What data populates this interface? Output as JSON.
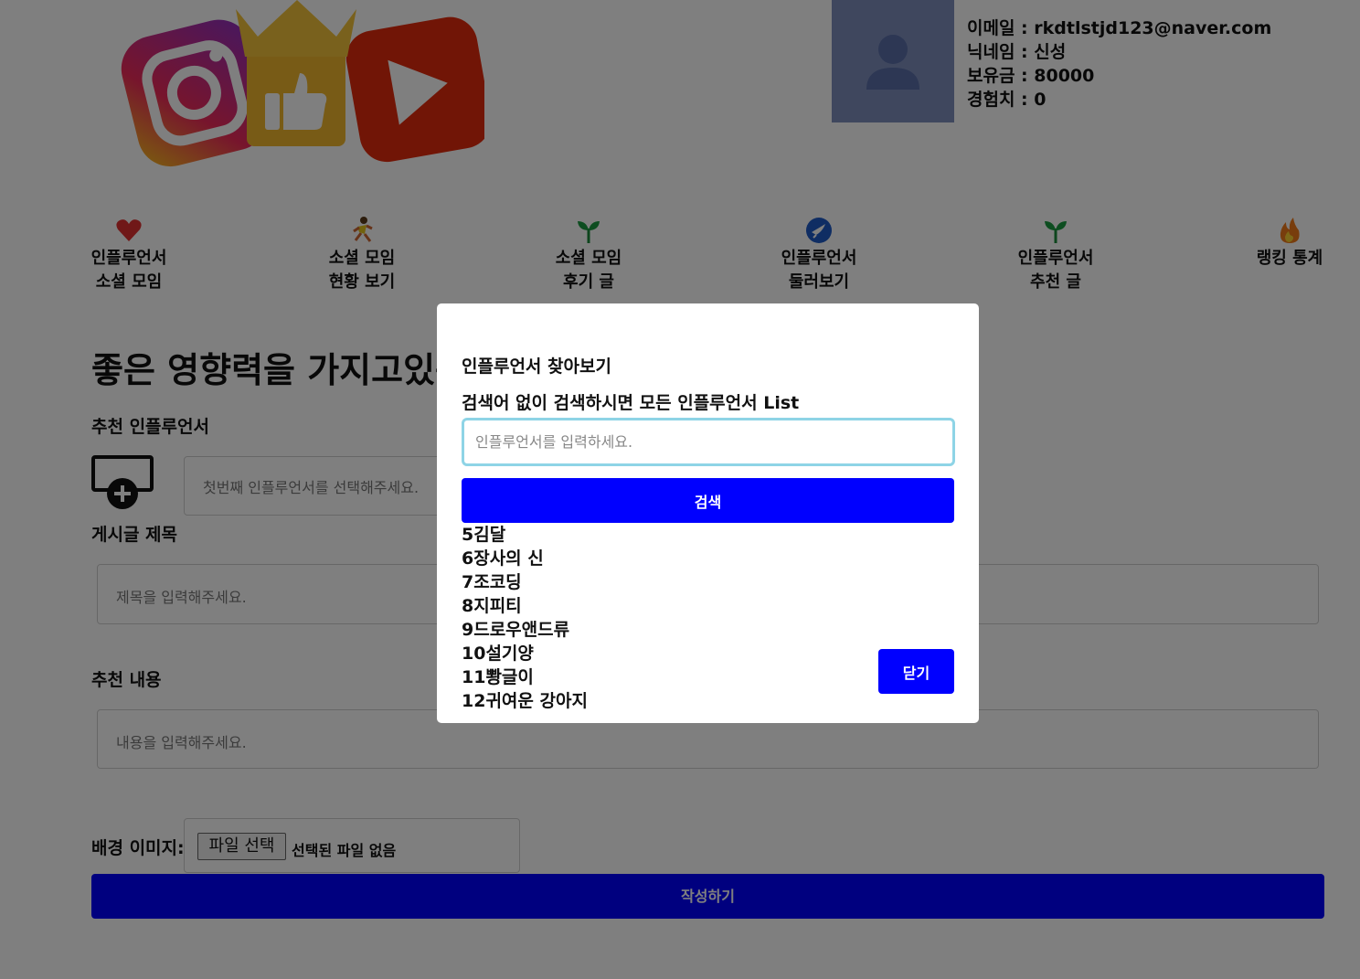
{
  "profile": {
    "email": "이메일 : rkdtlstjd123@naver.com",
    "nickname": "닉네임 : 신성",
    "balance": "보유금 : 80000",
    "experience": "경험치 : 0"
  },
  "nav": {
    "items": [
      {
        "label": "인플루언서\n소셜 모임",
        "icon": "heart-icon"
      },
      {
        "label": "소셜 모임\n현황 보기",
        "icon": "runner-icon"
      },
      {
        "label": "소셜 모임\n후기 글",
        "icon": "sprout-icon"
      },
      {
        "label": "인플루언서\n둘러보기",
        "icon": "bird-icon"
      },
      {
        "label": "인플루언서\n추천 글",
        "icon": "sprout-icon"
      },
      {
        "label": "랭킹 통계",
        "icon": "fire-icon"
      }
    ]
  },
  "main": {
    "title": "좋은 영향력을 가지고있는",
    "recommend_label": "추천 인플루언서",
    "select_placeholder": "첫번째 인플루언서를 선택해주세요.",
    "post_title_label": "게시글 제목",
    "post_title_placeholder": "제목을 입력해주세요.",
    "content_label": "추천 내용",
    "content_placeholder": "내용을 입력해주세요.",
    "bg_image_label": "배경 이미지:",
    "file_button": "파일 선택",
    "file_status": "선택된 파일 없음",
    "submit": "작성하기"
  },
  "modal": {
    "title": "인플루언서 찾아보기",
    "hint": "검색어 없이 검색하시면 모든 인플루언서 List",
    "search_placeholder": "인플루언서를 입력하세요.",
    "search_button": "검색",
    "results": [
      "5김달",
      "6장사의 신",
      "7조코딩",
      "8지피티",
      "9드로우앤드류",
      "10설기양",
      "11뽱글이",
      "12귀여운 강아지"
    ],
    "close_button": "닫기"
  },
  "colors": {
    "primary": "#0000ff",
    "input_focus": "#8ed4e6",
    "overlay": "rgba(0,0,0,0.5)"
  }
}
